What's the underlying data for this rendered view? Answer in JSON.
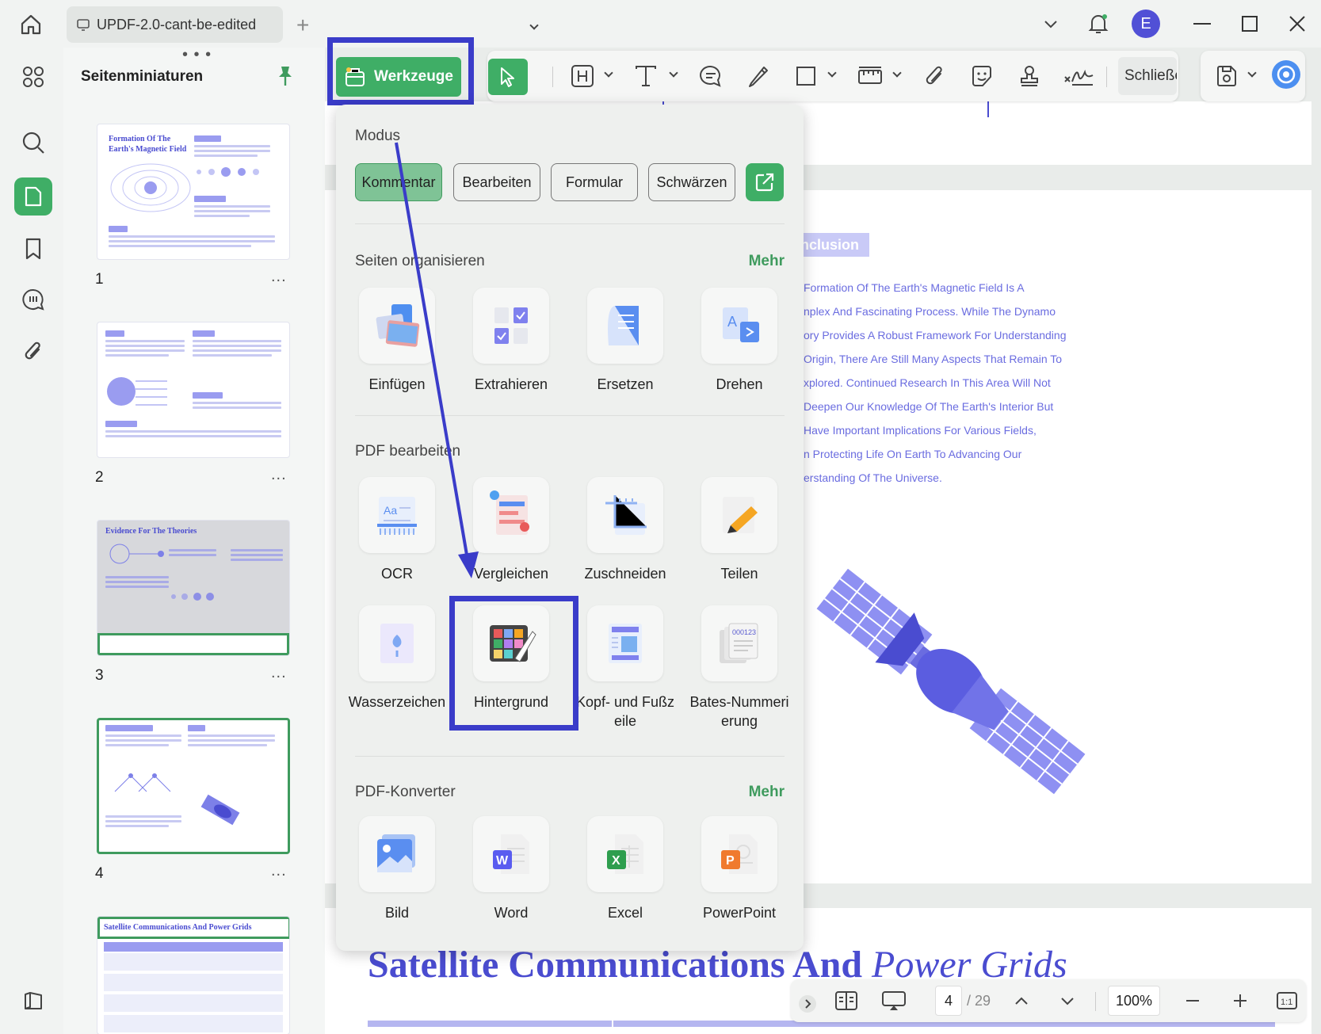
{
  "window": {
    "tab_title": "UPDF-2.0-cant-be-edited",
    "new_tab": "+",
    "avatar_letter": "E"
  },
  "thumbnails": {
    "title": "Seitenminiaturen",
    "pages": [
      {
        "number": "1",
        "heading": "Formation Of The Earth's Magnetic Field"
      },
      {
        "number": "2",
        "heading": ""
      },
      {
        "number": "3",
        "heading": "Evidence For The Theories"
      },
      {
        "number": "4",
        "heading": ""
      },
      {
        "number": "",
        "heading": "Satellite Communications And Power Grids"
      }
    ],
    "more": "..."
  },
  "toolbar": {
    "werkzeuge_label": "Werkzeuge",
    "close_label": "Schließen"
  },
  "panel": {
    "modus_title": "Modus",
    "modes": [
      "Kommentar",
      "Bearbeiten",
      "Formular",
      "Schwärzen"
    ],
    "organize": {
      "title": "Seiten organisieren",
      "more": "Mehr",
      "tools": [
        "Einfügen",
        "Extrahieren",
        "Ersetzen",
        "Drehen"
      ]
    },
    "edit": {
      "title": "PDF bearbeiten",
      "tools": [
        "OCR",
        "Vergleichen",
        "Zuschneiden",
        "Teilen",
        "Wasserzeichen",
        "Hintergrund",
        "Kopf- und Fußzeile",
        "Bates-Nummerierung"
      ]
    },
    "convert": {
      "title": "PDF-Konverter",
      "more": "Mehr",
      "tools": [
        "Bild",
        "Word",
        "Excel",
        "PowerPoint"
      ]
    }
  },
  "document": {
    "conclusion_tag": "Conclusion",
    "lines": [
      "Formation Of The Earth's Magnetic Field Is A",
      "nplex And Fascinating Process. While The Dynamo",
      "ory Provides A Robust Framework For Understanding",
      "Origin, There Are Still Many Aspects That Remain To",
      "xplored. Continued Research In This Area Will Not",
      "Deepen Our Knowledge Of The Earth's Interior But",
      "Have Important Implications For Various Fields,",
      "n Protecting Life On Earth To Advancing Our",
      "erstanding Of The Universe."
    ],
    "heading_main": "Satellite Communications And ",
    "heading_italic": "Power Grids"
  },
  "navigation": {
    "current_page": "4",
    "total_pages": "/ 29",
    "zoom": "100%"
  },
  "colors": {
    "accent_green": "#3fae66",
    "highlight_blue": "#3a3cc9",
    "doc_purple": "#6a6ce0"
  }
}
